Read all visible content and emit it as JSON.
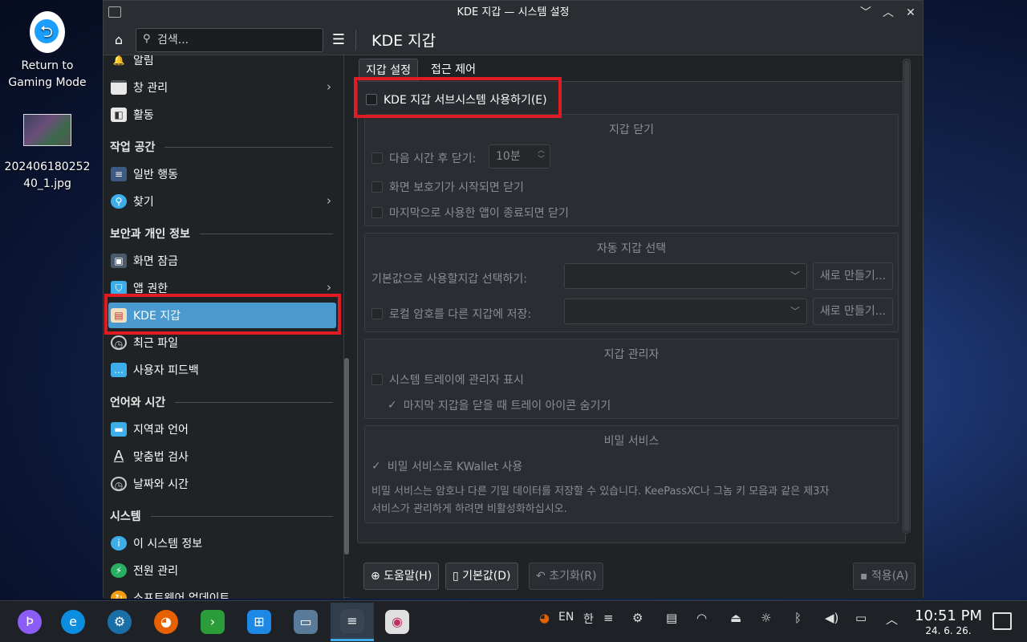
{
  "desktop": {
    "icons": [
      {
        "label_line1": "Return to",
        "label_line2": "Gaming Mode"
      },
      {
        "label_line1": "202406180252",
        "label_line2": "40_1.jpg"
      }
    ]
  },
  "window": {
    "title": "KDE 지갑 — 시스템 설정",
    "controls": [
      "﹀",
      "︿",
      "✕"
    ]
  },
  "sidebar": {
    "search_placeholder": "검색...",
    "items": {
      "notifications": "알림",
      "window_management": "창 관리",
      "activities": "활동",
      "workspace_section": "작업 공간",
      "general_behavior": "일반 행동",
      "search": "찾기",
      "security_section": "보안과 개인 정보",
      "screen_locking": "화면 잠금",
      "app_permissions": "앱 권한",
      "kde_wallet": "KDE 지갑",
      "recent_files": "최근 파일",
      "user_feedback": "사용자 피드백",
      "language_section": "언어와 시간",
      "region_language": "지역과 언어",
      "spell_check": "맞춤법 검사",
      "date_time": "날짜와 시간",
      "system_section": "시스템",
      "about_system": "이 시스템 정보",
      "power_management": "전원 관리",
      "software_update": "소프트웨어 업데이트"
    }
  },
  "page": {
    "title": "KDE 지갑",
    "tabs": [
      "지갑 설정",
      "접근 제어"
    ],
    "enable_checkbox": "KDE 지갑 서브시스템 사용하기(E)",
    "close_group": {
      "title": "지갑 닫기",
      "after_time": "다음 시간 후 닫기:",
      "time_value": "10분",
      "on_screensaver": "화면 보호기가 시작되면 닫기",
      "on_last_app": "마지막으로 사용한 앱이 종료되면 닫기"
    },
    "auto_group": {
      "title": "자동 지갑 선택",
      "default_label": "기본값으로 사용할지갑 선택하기:",
      "local_label": "로컬 암호를 다른 지갑에 저장:",
      "new_button": "새로 만들기..."
    },
    "manager_group": {
      "title": "지갑 관리자",
      "show_tray": "시스템 트레이에 관리자 표시",
      "hide_tray": "마지막 지갑을 닫을 때 트레이 아이콘 숨기기"
    },
    "secret_group": {
      "title": "비밀 서비스",
      "use_kwallet": "비밀 서비스로 KWallet 사용",
      "desc_line1": "비밀 서비스는 암호나 다른 기밀 데이터를 저장할 수 있습니다. KeePassXC나 그놈 키 모음과 같은 제3자",
      "desc_line2": "서비스가 관리하게 하려면 비활성화하십시오."
    },
    "buttons": {
      "help": "도움말(H)",
      "defaults": "기본값(D)",
      "reset": "초기화(R)",
      "apply": "적용(A)"
    }
  },
  "taskbar": {
    "lang": "EN",
    "ime": "한",
    "time": "10:51 PM",
    "date": "24. 6. 26."
  },
  "colors": {
    "accent": "#4a9ad0",
    "highlight_border": "#e01b24",
    "window_bg": "#202326"
  }
}
